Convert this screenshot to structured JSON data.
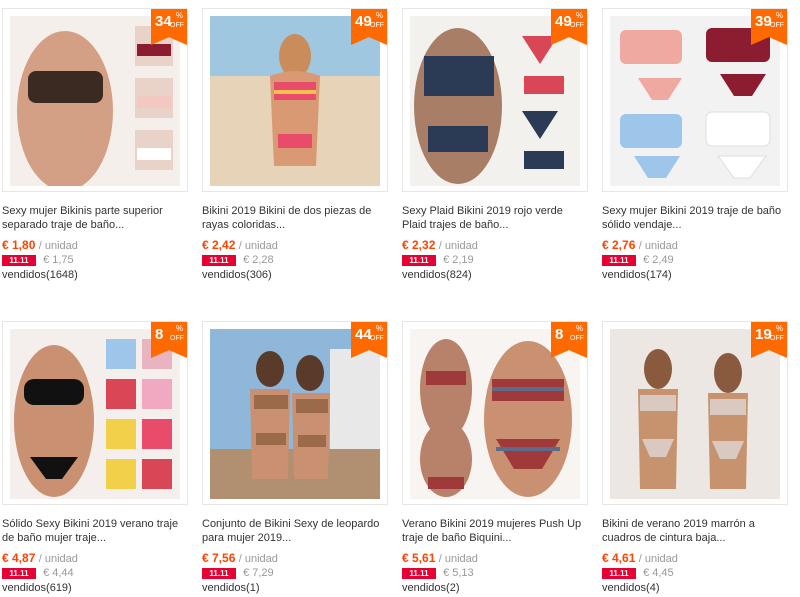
{
  "products": [
    {
      "title": "Sexy mujer Bikinis parte superior separado traje de baño...",
      "price": "€ 1,80",
      "unit": "/ unidad",
      "promo_label": "11.11",
      "promo_price": "€ 1,75",
      "sold": "vendidos(1648)",
      "discount": "34",
      "discount_symbol": "%",
      "discount_off": "OFF",
      "colors": [
        "#3a2a22",
        "#c08b6e",
        "#e9d3c9"
      ]
    },
    {
      "title": "Bikini 2019 Bikini de dos piezas de rayas coloridas...",
      "price": "€ 2,42",
      "unit": "/ unidad",
      "promo_label": "11.11",
      "promo_price": "€ 2,28",
      "sold": "vendidos(306)",
      "discount": "49",
      "discount_symbol": "%",
      "discount_off": "OFF",
      "colors": [
        "#e8d2b6",
        "#d99a73",
        "#e94b6a"
      ]
    },
    {
      "title": "Sexy Plaid Bikini 2019 rojo verde Plaid trajes de baño...",
      "price": "€ 2,32",
      "unit": "/ unidad",
      "promo_label": "11.11",
      "promo_price": "€ 2,19",
      "sold": "vendidos(824)",
      "discount": "49",
      "discount_symbol": "%",
      "discount_off": "OFF",
      "colors": [
        "#7b6a5e",
        "#2b3b55",
        "#d94656"
      ]
    },
    {
      "title": "Sexy mujer Bikini 2019 traje de baño sólido vendaje...",
      "price": "€ 2,76",
      "unit": "/ unidad",
      "promo_label": "11.11",
      "promo_price": "€ 2,49",
      "sold": "vendidos(174)",
      "discount": "39",
      "discount_symbol": "%",
      "discount_off": "OFF",
      "colors": [
        "#f0a9a0",
        "#8c1c2f",
        "#9ec6ea"
      ]
    },
    {
      "title": "Sólido Sexy Bikini 2019 verano traje de baño mujer traje...",
      "price": "€ 4,87",
      "unit": "/ unidad",
      "promo_label": "11.11",
      "promo_price": "€ 4,44",
      "sold": "vendidos(619)",
      "discount": "8",
      "discount_symbol": "%",
      "discount_off": "OFF",
      "colors": [
        "#111111",
        "#c99071",
        "#f2d04a"
      ]
    },
    {
      "title": "Conjunto de Bikini Sexy de leopardo para mujer 2019...",
      "price": "€ 7,56",
      "unit": "/ unidad",
      "promo_label": "11.11",
      "promo_price": "€ 7,29",
      "sold": "vendidos(1)",
      "discount": "44",
      "discount_symbol": "%",
      "discount_off": "OFF",
      "colors": [
        "#8fb7d9",
        "#9b6a4b",
        "#5a3b2a"
      ]
    },
    {
      "title": "Verano Bikini 2019 mujeres Push Up traje de baño Biquini...",
      "price": "€ 5,61",
      "unit": "/ unidad",
      "promo_label": "11.11",
      "promo_price": "€ 5,13",
      "sold": "vendidos(2)",
      "discount": "8",
      "discount_symbol": "%",
      "discount_off": "OFF",
      "colors": [
        "#b8826a",
        "#a03a3a",
        "#5c6b8a"
      ]
    },
    {
      "title": "Bikini de verano 2019 marrón a cuadros de cintura baja...",
      "price": "€ 4,61",
      "unit": "/ unidad",
      "promo_label": "11.11",
      "promo_price": "€ 4,45",
      "sold": "vendidos(4)",
      "discount": "19",
      "discount_symbol": "%",
      "discount_off": "OFF",
      "colors": [
        "#d9c9c0",
        "#c7936f",
        "#8a5a3e"
      ]
    }
  ]
}
